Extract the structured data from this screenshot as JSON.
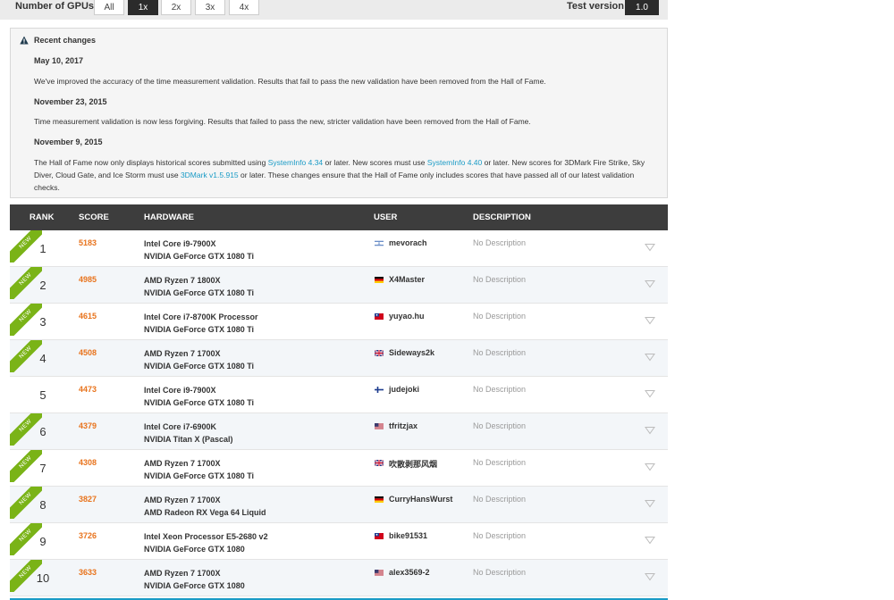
{
  "filter": {
    "gpu_label": "Number of GPUs:",
    "gpu_options": [
      "All",
      "1x",
      "2x",
      "3x",
      "4x"
    ],
    "gpu_selected": "1x",
    "test_version_label": "Test version:",
    "test_version_value": "1.0"
  },
  "changes": {
    "title": "Recent changes",
    "entries": [
      {
        "date": "May 10, 2017",
        "text": "We've improved the accuracy of the time measurement validation. Results that fail to pass the new validation have been removed from the Hall of Fame."
      },
      {
        "date": "November 23, 2015",
        "text": "Time measurement validation is now less forgiving. Results that failed to pass the new, stricter validation have been removed from the Hall of Fame."
      },
      {
        "date": "November 9, 2015",
        "text_parts": [
          "The Hall of Fame now only displays historical scores submitted using ",
          "SystemInfo 4.34",
          " or later. New scores must use ",
          "SystemInfo 4.40",
          " or later. New scores for 3DMark Fire Strike, Sky Diver, Cloud Gate, and Ice Storm must use ",
          "3DMark v1.5.915",
          " or later. These changes ensure that the Hall of Fame only includes scores that have passed all of our latest validation checks."
        ]
      }
    ]
  },
  "table": {
    "headers": [
      "RANK",
      "SCORE",
      "HARDWARE",
      "USER",
      "DESCRIPTION"
    ],
    "new_label": "NEW",
    "rows": [
      {
        "rank": "1",
        "is_new": true,
        "score": "5183",
        "cpu": "Intel Core i9-7900X",
        "gpu": "NVIDIA GeForce GTX 1080 Ti",
        "flag": "israel",
        "user": "mevorach",
        "description": "No Description"
      },
      {
        "rank": "2",
        "is_new": true,
        "score": "4985",
        "cpu": "AMD Ryzen 7 1800X",
        "gpu": "NVIDIA GeForce GTX 1080 Ti",
        "flag": "germany",
        "user": "X4Master",
        "description": "No Description"
      },
      {
        "rank": "3",
        "is_new": true,
        "score": "4615",
        "cpu": "Intel Core i7-8700K Processor",
        "gpu": "NVIDIA GeForce GTX 1080 Ti",
        "flag": "taiwan",
        "user": "yuyao.hu",
        "description": "No Description"
      },
      {
        "rank": "4",
        "is_new": true,
        "score": "4508",
        "cpu": "AMD Ryzen 7 1700X",
        "gpu": "NVIDIA GeForce GTX 1080 Ti",
        "flag": "uk",
        "user": "Sideways2k",
        "description": "No Description"
      },
      {
        "rank": "5",
        "is_new": false,
        "score": "4473",
        "cpu": "Intel Core i9-7900X",
        "gpu": "NVIDIA GeForce GTX 1080 Ti",
        "flag": "finland",
        "user": "judejoki",
        "description": "No Description"
      },
      {
        "rank": "6",
        "is_new": true,
        "score": "4379",
        "cpu": "Intel Core i7-6900K",
        "gpu": "NVIDIA Titan X (Pascal)",
        "flag": "usa",
        "user": "tfritzjax",
        "description": "No Description"
      },
      {
        "rank": "7",
        "is_new": true,
        "score": "4308",
        "cpu": "AMD Ryzen 7 1700X",
        "gpu": "NVIDIA GeForce GTX 1080 Ti",
        "flag": "uk",
        "user": "吹散剥那风烟",
        "description": "No Description"
      },
      {
        "rank": "8",
        "is_new": true,
        "score": "3827",
        "cpu": "AMD Ryzen 7 1700X",
        "gpu": "AMD Radeon RX Vega 64 Liquid",
        "flag": "germany",
        "user": "CurryHansWurst",
        "description": "No Description"
      },
      {
        "rank": "9",
        "is_new": true,
        "score": "3726",
        "cpu": "Intel Xeon Processor E5-2680 v2",
        "gpu": "NVIDIA GeForce GTX 1080",
        "flag": "taiwan",
        "user": "bike91531",
        "description": "No Description"
      },
      {
        "rank": "10",
        "is_new": true,
        "score": "3633",
        "cpu": "AMD Ryzen 7 1700X",
        "gpu": "NVIDIA GeForce GTX 1080",
        "flag": "usa",
        "user": "alex3569-2",
        "description": "No Description"
      }
    ]
  },
  "colors": {
    "accent_link": "#1a9bc6",
    "score": "#e8731c",
    "new_badge": "#7ab317",
    "header_bg": "#3d3d3d"
  }
}
